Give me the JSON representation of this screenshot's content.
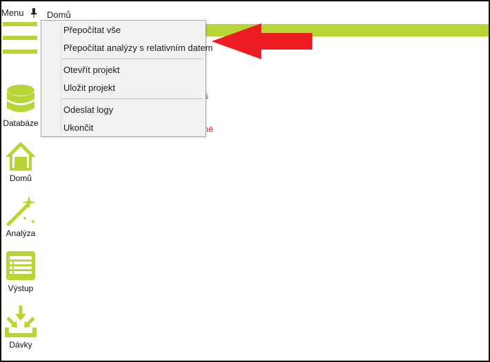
{
  "window": {
    "menu_label": "Menu",
    "tab_home": "Domů"
  },
  "sidebar": {
    "items": [
      {
        "label": "Databáze",
        "icon": "database-icon"
      },
      {
        "label": "Domů",
        "icon": "home-icon"
      },
      {
        "label": "Analýza",
        "icon": "magic-wand-icon"
      },
      {
        "label": "Výstup",
        "icon": "list-output-icon"
      },
      {
        "label": "Dávky",
        "icon": "batch-import-icon"
      }
    ]
  },
  "dropdown": {
    "items": [
      {
        "label": "Přepočítat vše"
      },
      {
        "label": "Přepočítat analýzy s relativním datem"
      },
      {
        "label": "Otevřít projekt"
      },
      {
        "label": "Uložit projekt"
      },
      {
        "label": "Odeslat logy"
      },
      {
        "label": "Ukončit"
      }
    ]
  },
  "background_text": {
    "fragment_1": "ů",
    "fragment_2": "ně"
  },
  "colors": {
    "accent_green": "#b7d636",
    "annotation_red": "#ec1c24",
    "warning_text_red": "#e32626"
  }
}
